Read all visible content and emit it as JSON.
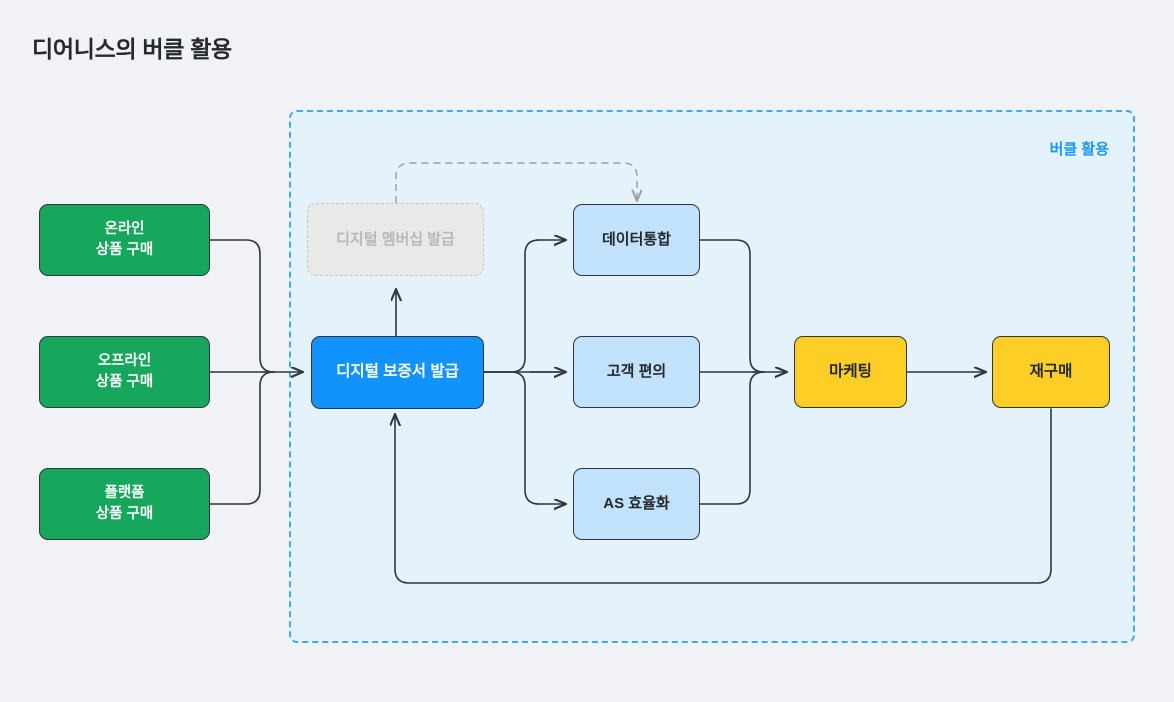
{
  "page": {
    "title": "디어니스의 버클 활용",
    "background_color": "#f1f2f5"
  },
  "container": {
    "label": "버클 활용",
    "fill_color": "#e4f2fc",
    "border_color": "#3fa9f5",
    "label_color": "#1c97f5"
  },
  "diagram": {
    "type": "flowchart",
    "nodes": {
      "source_online": {
        "line1": "온라인",
        "line2": "상품 구매",
        "color": "#16a75c"
      },
      "source_offline": {
        "line1": "오프라인",
        "line2": "상품 구매",
        "color": "#16a75c"
      },
      "source_platform": {
        "line1": "플랫폼",
        "line2": "상품 구매",
        "color": "#16a75c"
      },
      "membership": {
        "label": "디지털 멤버십 발급",
        "color": "#e9e9e7",
        "state": "disabled"
      },
      "warranty": {
        "label": "디지털 보증서 발급",
        "color": "#1292fb"
      },
      "benefit_data": {
        "label": "데이터통합",
        "color": "#c2e1fb"
      },
      "benefit_convenience": {
        "label": "고객 편의",
        "color": "#c2e1fb"
      },
      "benefit_as": {
        "label": "AS 효율화",
        "color": "#c2e1fb"
      },
      "marketing": {
        "label": "마케팅",
        "color": "#fdcf26"
      },
      "repurchase": {
        "label": "재구매",
        "color": "#fdcf26"
      }
    },
    "edges": [
      {
        "from": "source_online",
        "to": "warranty",
        "style": "solid"
      },
      {
        "from": "source_offline",
        "to": "warranty",
        "style": "solid"
      },
      {
        "from": "source_platform",
        "to": "warranty",
        "style": "solid"
      },
      {
        "from": "warranty",
        "to": "membership",
        "style": "solid"
      },
      {
        "from": "warranty",
        "to": "benefit_data",
        "style": "solid"
      },
      {
        "from": "warranty",
        "to": "benefit_convenience",
        "style": "solid"
      },
      {
        "from": "warranty",
        "to": "benefit_as",
        "style": "solid"
      },
      {
        "from": "benefit_data",
        "to": "marketing",
        "style": "solid"
      },
      {
        "from": "benefit_convenience",
        "to": "marketing",
        "style": "solid"
      },
      {
        "from": "benefit_as",
        "to": "marketing",
        "style": "solid"
      },
      {
        "from": "marketing",
        "to": "repurchase",
        "style": "solid"
      },
      {
        "from": "repurchase",
        "to": "warranty",
        "style": "solid"
      },
      {
        "from": "membership",
        "to": "benefit_data",
        "style": "dashed"
      }
    ]
  }
}
